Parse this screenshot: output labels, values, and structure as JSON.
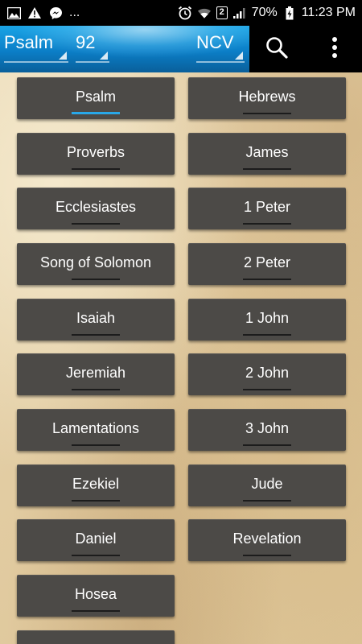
{
  "status_bar": {
    "battery_percent": "70%",
    "time": "11:23 PM",
    "sim_badge": "2",
    "dots": "..."
  },
  "toolbar": {
    "book": "Psalm",
    "chapter": "92",
    "version": "NCV"
  },
  "books_left": [
    "Psalm",
    "Proverbs",
    "Ecclesiastes",
    "Song of Solomon",
    "Isaiah",
    "Jeremiah",
    "Lamentations",
    "Ezekiel",
    "Daniel",
    "Hosea"
  ],
  "books_right": [
    "Hebrews",
    "James",
    "1 Peter",
    "2 Peter",
    "1 John",
    "2 John",
    "3 John",
    "Jude",
    "Revelation"
  ],
  "selected_book": "Psalm"
}
